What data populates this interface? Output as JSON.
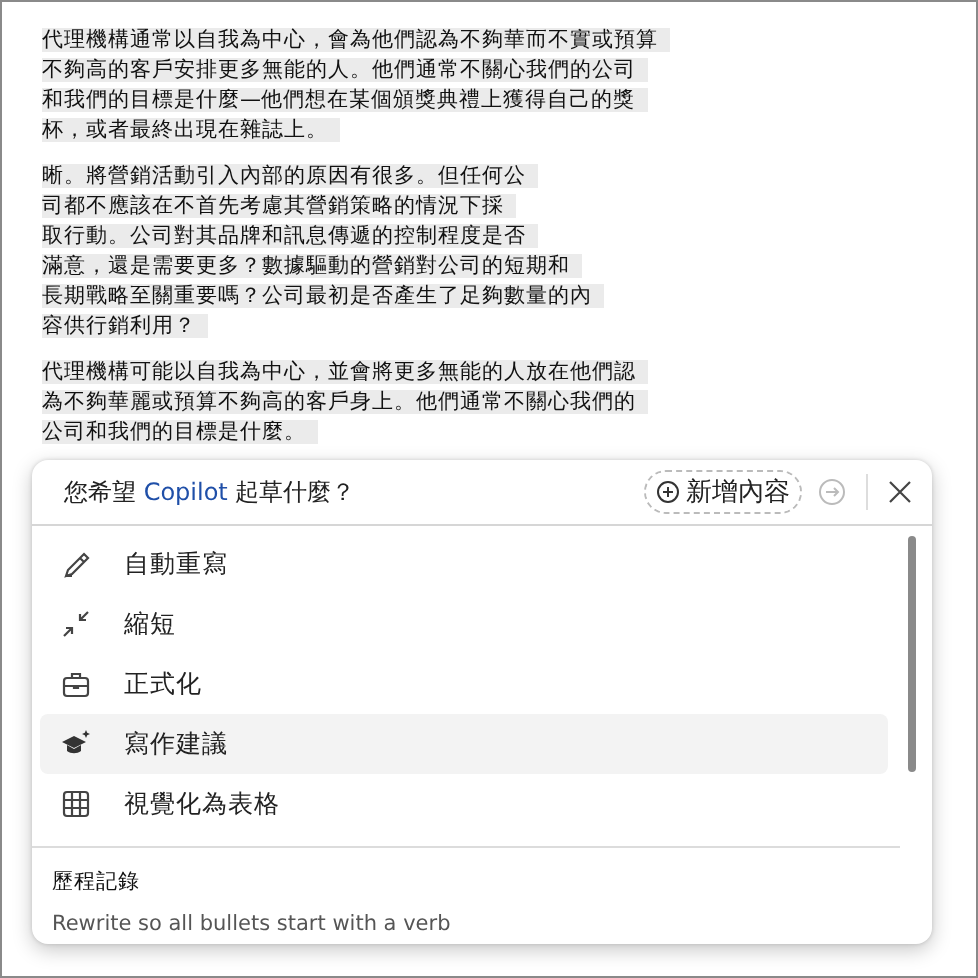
{
  "document": {
    "paragraphs": [
      {
        "lines": [
          "代理機構通常以自我為中心，會為他們認為不夠華而不實或預算",
          "不夠高的客戶安排更多無能的人。他們通常不關心我們的公司",
          "和我們的目標是什麼—他們想在某個頒獎典禮上獲得自己的獎",
          "杯，或者最終出現在雜誌上。"
        ]
      },
      {
        "lines": [
          "晰。將營銷活動引入內部的原因有很多。但任何公",
          "司都不應該在不首先考慮其營銷策略的情況下採",
          "取行動。公司對其品牌和訊息傳遞的控制程度是否",
          "滿意，還是需要更多？數據驅動的營銷對公司的短期和",
          "長期戰略至關重要嗎？公司最初是否產生了足夠數量的內",
          "容供行銷利用？"
        ]
      },
      {
        "lines": [
          "代理機構可能以自我為中心，並會將更多無能的人放在他們認",
          "為不夠華麗或預算不夠高的客戶身上。他們通常不關心我們的",
          "公司和我們的目標是什麼。"
        ]
      }
    ]
  },
  "copilot_panel": {
    "prompt": [
      {
        "kind": "plain",
        "text": "您希望 "
      },
      {
        "kind": "brand",
        "text": "Copilot"
      },
      {
        "kind": "plain",
        "text": " 起草什麼？"
      }
    ],
    "add_content_button": "新增內容",
    "menu_items": [
      {
        "kind": "pencil",
        "label": "自動重寫",
        "selected": false
      },
      {
        "kind": "shrink",
        "label": "縮短",
        "selected": false
      },
      {
        "kind": "briefcase",
        "label": "正式化",
        "selected": false
      },
      {
        "kind": "cap",
        "label": "寫作建議",
        "selected": true
      },
      {
        "kind": "table",
        "label": "視覺化為表格",
        "selected": false
      }
    ],
    "history_heading": "歷程記錄",
    "history_items": [
      "Rewrite so all bullets start with a verb"
    ]
  }
}
